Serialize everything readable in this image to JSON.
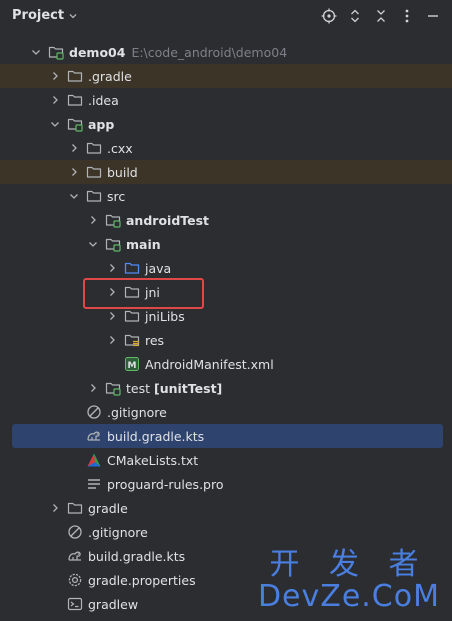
{
  "header": {
    "title": "Project"
  },
  "tree": [
    {
      "name": "demo04",
      "path": "E:\\code_android\\demo04",
      "bold": true,
      "icon": "module-folder-icon",
      "arrow": "expanded",
      "depth": 0
    },
    {
      "name": ".gradle",
      "icon": "folder-icon",
      "arrow": "collapsed",
      "depth": 1,
      "ignored": true
    },
    {
      "name": ".idea",
      "icon": "folder-icon",
      "arrow": "collapsed",
      "depth": 1
    },
    {
      "name": "app",
      "bold": true,
      "icon": "module-folder-icon",
      "arrow": "expanded",
      "depth": 1
    },
    {
      "name": ".cxx",
      "icon": "folder-icon",
      "arrow": "collapsed",
      "depth": 2
    },
    {
      "name": "build",
      "icon": "folder-icon",
      "arrow": "collapsed",
      "depth": 2,
      "ignored": true
    },
    {
      "name": "src",
      "icon": "folder-icon",
      "arrow": "expanded",
      "depth": 2
    },
    {
      "name": "androidTest",
      "bold": true,
      "icon": "test-folder-icon",
      "arrow": "collapsed",
      "depth": 3
    },
    {
      "name": "main",
      "bold": true,
      "icon": "source-folder-icon",
      "arrow": "expanded",
      "depth": 3
    },
    {
      "name": "java",
      "icon": "java-folder-icon",
      "arrow": "collapsed",
      "depth": 4
    },
    {
      "name": "jni",
      "icon": "folder-icon",
      "arrow": "collapsed",
      "depth": 4
    },
    {
      "name": "jniLibs",
      "icon": "folder-icon",
      "arrow": "collapsed",
      "depth": 4
    },
    {
      "name": "res",
      "icon": "resources-folder-icon",
      "arrow": "collapsed",
      "depth": 4
    },
    {
      "name": "AndroidManifest.xml",
      "icon": "manifest-icon",
      "arrow": "none",
      "depth": 4
    },
    {
      "name": "test",
      "suffix": "[unitTest]",
      "icon": "test-folder-icon",
      "arrow": "collapsed",
      "depth": 3
    },
    {
      "name": ".gitignore",
      "icon": "gitignore-icon",
      "arrow": "none",
      "depth": 2
    },
    {
      "name": "build.gradle.kts",
      "icon": "gradle-icon",
      "arrow": "none",
      "depth": 2,
      "selected": true
    },
    {
      "name": "CMakeLists.txt",
      "icon": "cmake-icon",
      "arrow": "none",
      "depth": 2
    },
    {
      "name": "proguard-rules.pro",
      "icon": "text-file-icon",
      "arrow": "none",
      "depth": 2
    },
    {
      "name": "gradle",
      "icon": "folder-icon",
      "arrow": "collapsed",
      "depth": 1
    },
    {
      "name": ".gitignore",
      "icon": "gitignore-icon",
      "arrow": "none",
      "depth": 1
    },
    {
      "name": "build.gradle.kts",
      "icon": "gradle-icon",
      "arrow": "none",
      "depth": 1
    },
    {
      "name": "gradle.properties",
      "icon": "settings-file-icon",
      "arrow": "none",
      "depth": 1
    },
    {
      "name": "gradlew",
      "icon": "terminal-file-icon",
      "arrow": "none",
      "depth": 1
    }
  ],
  "watermark": {
    "cn": "开 发 者",
    "en": "DevZe.CoM"
  },
  "colors": {
    "background": "#2b2d30",
    "selected": "#2e436e",
    "ignored": "#3d3428",
    "highlight": "#e04848"
  }
}
